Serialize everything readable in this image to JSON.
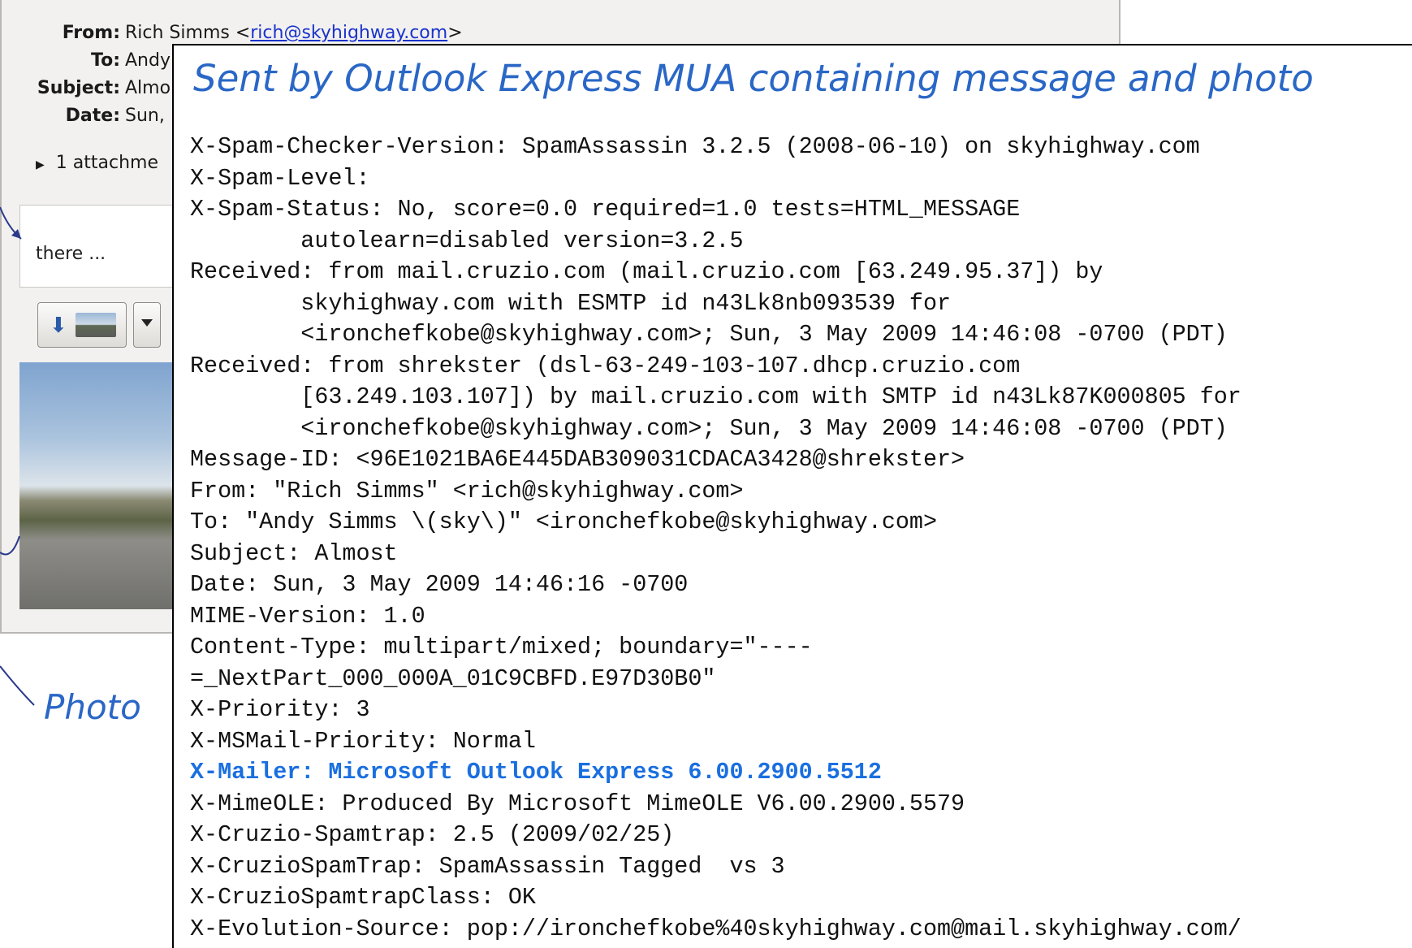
{
  "mail_window": {
    "headers": [
      {
        "label": "From:",
        "value": "Rich Simms <",
        "link": "rich@skyhighway.com",
        "suffix": ">"
      },
      {
        "label": "To:",
        "value": "Andy"
      },
      {
        "label": "Subject:",
        "value": "Almo"
      },
      {
        "label": "Date:",
        "value": "Sun,"
      }
    ],
    "attachments_label": "1 attachme",
    "preview_text": "there ...",
    "photo_label": "Photo"
  },
  "panel": {
    "title": "Sent by Outlook Express MUA containing message and photo",
    "lines": [
      "X-Spam-Checker-Version: SpamAssassin 3.2.5 (2008-06-10) on skyhighway.com",
      "X-Spam-Level:",
      "X-Spam-Status: No, score=0.0 required=1.0 tests=HTML_MESSAGE",
      "        autolearn=disabled version=3.2.5",
      "Received: from mail.cruzio.com (mail.cruzio.com [63.249.95.37]) by",
      "        skyhighway.com with ESMTP id n43Lk8nb093539 for",
      "        <ironchefkobe@skyhighway.com>; Sun, 3 May 2009 14:46:08 -0700 (PDT)",
      "Received: from shrekster (dsl-63-249-103-107.dhcp.cruzio.com",
      "        [63.249.103.107]) by mail.cruzio.com with SMTP id n43Lk87K000805 for",
      "        <ironchefkobe@skyhighway.com>; Sun, 3 May 2009 14:46:08 -0700 (PDT)",
      "Message-ID: <96E1021BA6E445DAB309031CDACA3428@shrekster>",
      "From: \"Rich Simms\" <rich@skyhighway.com>",
      "To: \"Andy Simms \\(sky\\)\" <ironchefkobe@skyhighway.com>",
      "Subject: Almost",
      "Date: Sun, 3 May 2009 14:46:16 -0700",
      "MIME-Version: 1.0",
      "Content-Type: multipart/mixed; boundary=\"----",
      "=_NextPart_000_000A_01C9CBFD.E97D30B0\"",
      "X-Priority: 3",
      "X-MSMail-Priority: Normal",
      "X-Mailer: Microsoft Outlook Express 6.00.2900.5512",
      "X-MimeOLE: Produced By Microsoft MimeOLE V6.00.2900.5579",
      "X-Cruzio-Spamtrap: 2.5 (2009/02/25)",
      "X-CruzioSpamTrap: SpamAssassin Tagged  vs 3",
      "X-CruzioSpamtrapClass: OK",
      "X-Evolution-Source: pop://ironchefkobe%40skyhighway.com@mail.skyhighway.com/"
    ],
    "highlight_color": "#1a6fe0"
  }
}
